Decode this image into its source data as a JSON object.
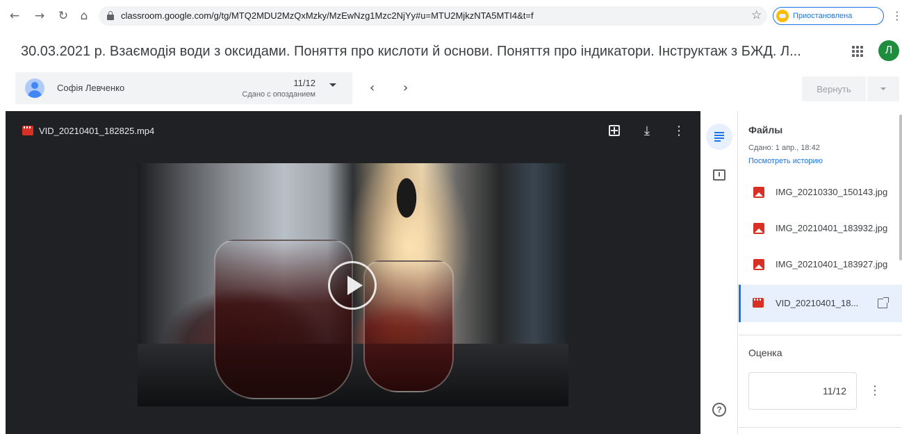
{
  "browser": {
    "url": "classroom.google.com/g/tg/MTQ2MDU2MzQxMzky/MzEwNzg1Mzc2NjYy#u=MTU2MjkzNTA5MTI4&t=f",
    "profile_status": "Приостановлена"
  },
  "header": {
    "title": "30.03.2021 р. Взаємодія води з оксидами. Поняття про кислоти й основи. Поняття про індикатори. Інструктаж з БЖД. Л...",
    "user_initial": "Л"
  },
  "student": {
    "name": "Софія Левченко",
    "grade": "11/12",
    "status": "Сдано с опозданием"
  },
  "actions": {
    "return_label": "Вернуть"
  },
  "viewer": {
    "file_name": "VID_20210401_182825.mp4"
  },
  "panel": {
    "files_title": "Файлы",
    "submitted": "Сдано: 1 апр., 18:42",
    "history_link": "Посмотреть историю",
    "files": [
      {
        "name": "IMG_20210330_150143.jpg",
        "icon": "image-icon"
      },
      {
        "name": "IMG_20210401_183932.jpg",
        "icon": "image-icon"
      },
      {
        "name": "IMG_20210401_183927.jpg",
        "icon": "image-icon"
      },
      {
        "name": "VID_20210401_18...",
        "icon": "video-icon"
      }
    ],
    "grade_title": "Оценка",
    "grade_value": "11/12"
  },
  "colors": {
    "accent": "#1a73e8",
    "file_icon": "#d93025",
    "avatar": "#1e8e3e",
    "viewer_bg": "#202124"
  }
}
